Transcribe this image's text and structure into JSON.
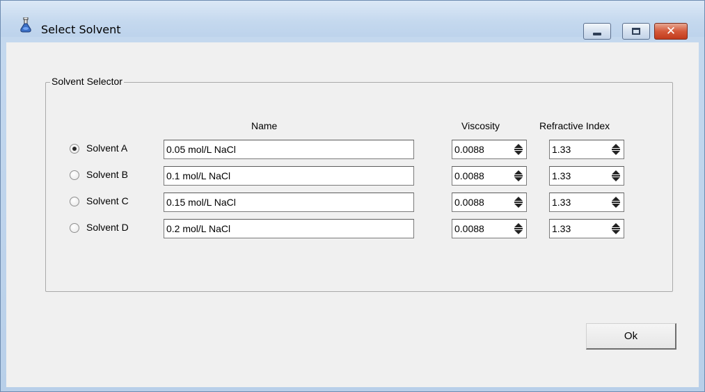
{
  "window": {
    "title": "Select Solvent",
    "icon": "flask-icon",
    "controls": {
      "minimize": "minimize-icon",
      "maximize": "maximize-icon",
      "close_label": "✕"
    }
  },
  "group": {
    "label": "Solvent Selector"
  },
  "columns": {
    "name": "Name",
    "viscosity": "Viscosity",
    "refractive_index": "Refractive Index"
  },
  "solvents": [
    {
      "label": "Solvent A",
      "name": "0.05 mol/L NaCl",
      "viscosity": "0.0088",
      "refractive_index": "1.33",
      "selected": true
    },
    {
      "label": "Solvent B",
      "name": "0.1 mol/L NaCl",
      "viscosity": "0.0088",
      "refractive_index": "1.33",
      "selected": false
    },
    {
      "label": "Solvent C",
      "name": "0.15 mol/L NaCl",
      "viscosity": "0.0088",
      "refractive_index": "1.33",
      "selected": false
    },
    {
      "label": "Solvent D",
      "name": "0.2 mol/L NaCl",
      "viscosity": "0.0088",
      "refractive_index": "1.33",
      "selected": false
    }
  ],
  "buttons": {
    "ok": "Ok"
  },
  "colors": {
    "title_gradient": "#c4d8ee",
    "close_red": "#c23b1c",
    "client_bg": "#f0f0f0"
  }
}
